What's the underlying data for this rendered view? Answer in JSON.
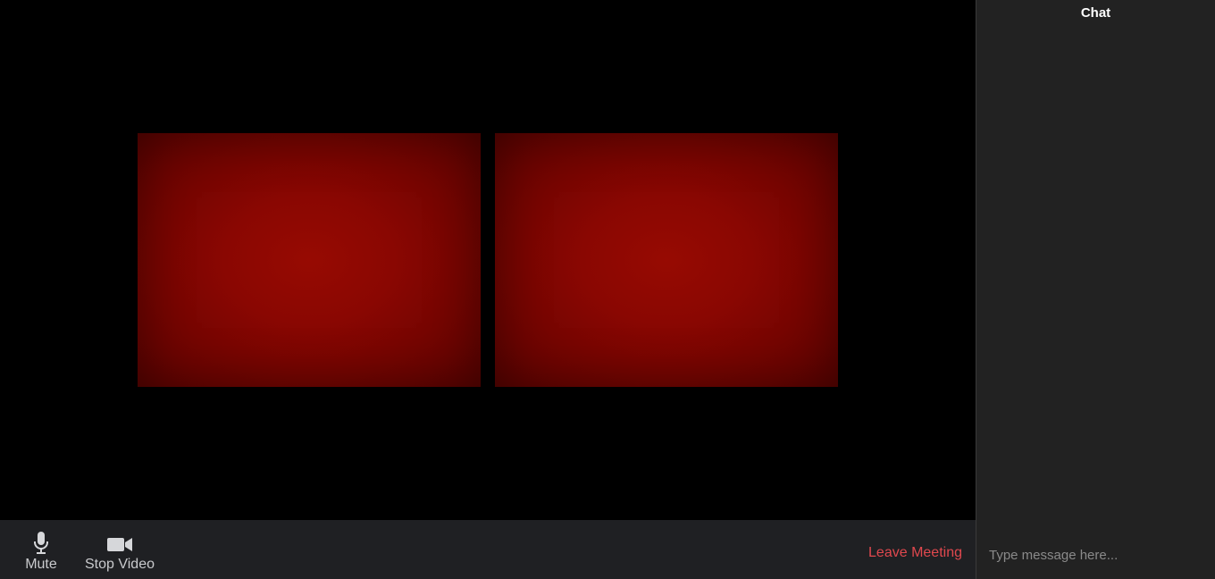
{
  "colors": {
    "stage_background": "#000000",
    "video_tile": "#8a0702",
    "toolbar_background": "#1f2023",
    "toolbar_text": "#c9cacd",
    "leave_text": "#e0484e",
    "chat_background": "#222222"
  },
  "videos": {
    "tiles": [
      {
        "participant": ""
      },
      {
        "participant": ""
      }
    ]
  },
  "toolbar": {
    "mute": {
      "label": "Mute",
      "icon": "microphone-icon"
    },
    "stop_video": {
      "label": "Stop Video",
      "icon": "video-camera-icon"
    },
    "leave_label": "Leave Meeting"
  },
  "chat": {
    "title": "Chat",
    "input_placeholder": "Type message here...",
    "input_value": ""
  }
}
